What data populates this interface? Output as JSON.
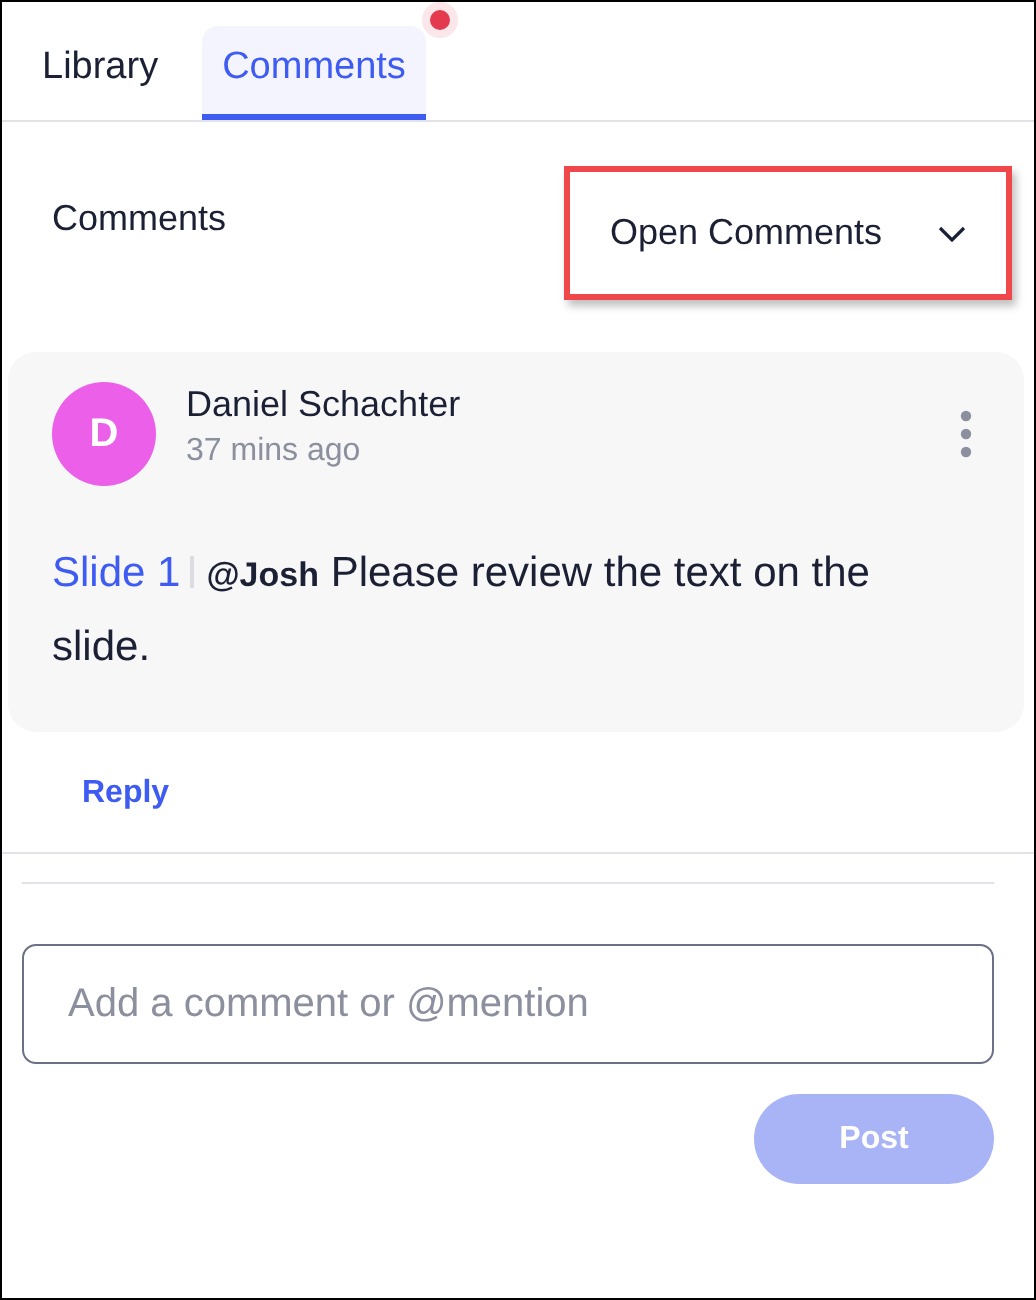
{
  "tabs": [
    {
      "label": "Library",
      "selected": false,
      "badge": false
    },
    {
      "label": "Comments",
      "selected": true,
      "badge": true
    }
  ],
  "header": {
    "title": "Comments",
    "filter": {
      "value": "Open Comments",
      "highlighted": true
    }
  },
  "comments": [
    {
      "avatar_letter": "D",
      "color": "#ec5fe9",
      "author": "Daniel Schachter",
      "time": "37 mins ago",
      "slide_ref": "Slide 1",
      "text": "**@Josh** Please review the text on the slide.",
      "reply": "Reply"
    }
  ],
  "composer": {
    "placeholder": "Add a comment or @mention",
    "button": "Post",
    "disabled": true
  }
}
